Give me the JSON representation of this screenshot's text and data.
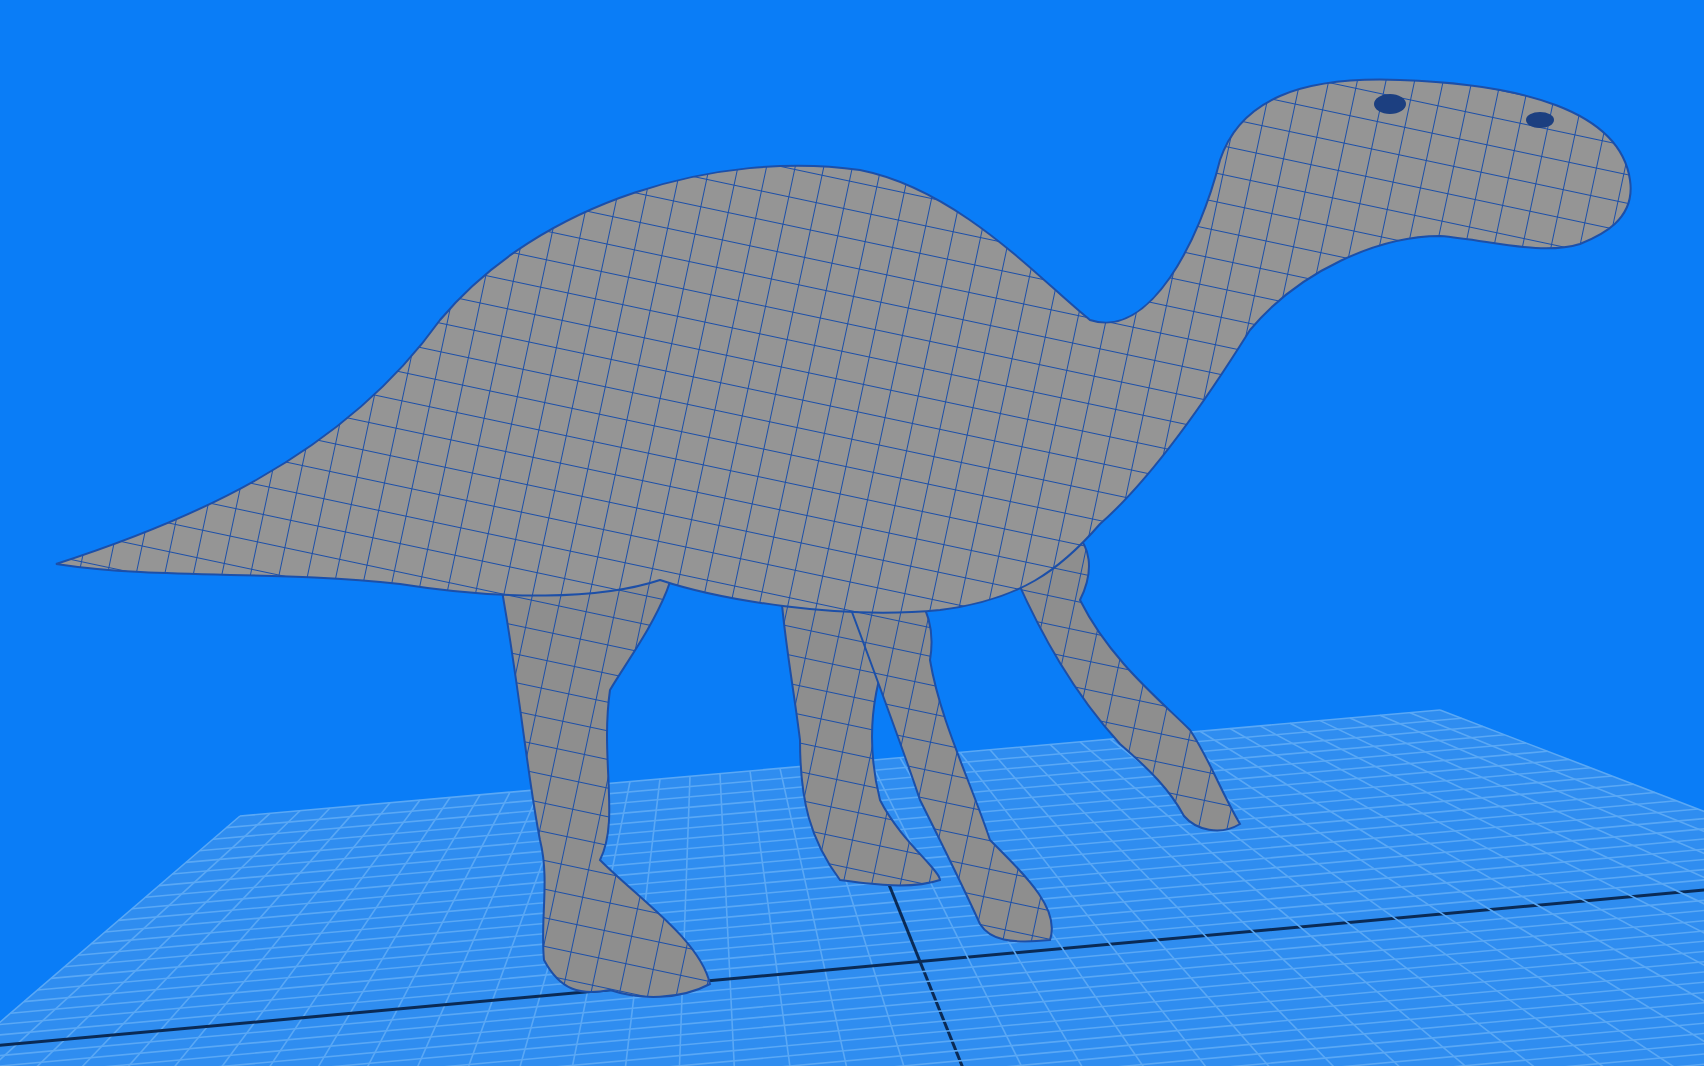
{
  "viewport": {
    "show_grid": true,
    "show_wireframe": true
  }
}
